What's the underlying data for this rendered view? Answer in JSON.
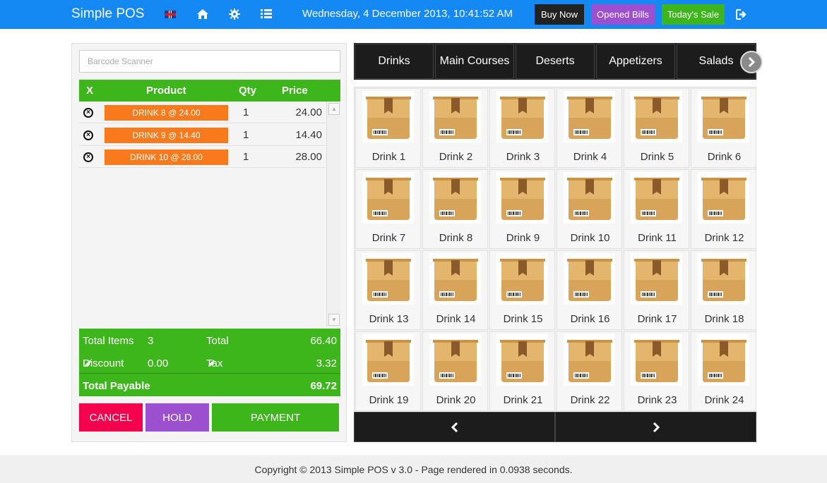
{
  "nav": {
    "brand": "Simple POS",
    "language_icon": "uk-flag-icon",
    "date": "Wednesday, 4 December 2013, 10:41:52 AM",
    "buy_now": "Buy Now",
    "opened_bills": "Opened Bills",
    "todays_sale": "Today's Sale",
    "icons": [
      "home-icon",
      "gear-icon",
      "list-icon",
      "logout-icon"
    ]
  },
  "colors": {
    "navbar": "#1489f4",
    "green": "#3db61c",
    "orange": "#f87a1c",
    "purple": "#9c4fce",
    "red": "#f5004c",
    "dark": "#1c1c1c"
  },
  "order": {
    "barcode_placeholder": "Barcode Scanner",
    "headers": {
      "x": "X",
      "product": "Product",
      "qty": "Qty",
      "price": "Price"
    },
    "items": [
      {
        "product": "DRINK 8 @ 24.00",
        "qty": "1",
        "price": "24.00"
      },
      {
        "product": "DRINK 9 @ 14.40",
        "qty": "1",
        "price": "14.40"
      },
      {
        "product": "DRINK 10 @ 28.00",
        "qty": "1",
        "price": "28.00"
      }
    ],
    "totals": {
      "items_label": "Total Items",
      "items_value": "3",
      "total_label": "Total",
      "total_value": "66.40",
      "discount_label": "Discount",
      "discount_value": "0.00",
      "tax_label": "Tax",
      "tax_value": "3.32",
      "payable_label": "Total Payable",
      "payable_value": "69.72"
    },
    "actions": {
      "cancel": "CANCEL",
      "hold": "HOLD",
      "payment": "PAYMENT"
    }
  },
  "categories": [
    "Drinks",
    "Main Courses",
    "Deserts",
    "Appetizers",
    "Salads"
  ],
  "products": [
    "Drink 1",
    "Drink 2",
    "Drink 3",
    "Drink 4",
    "Drink 5",
    "Drink 6",
    "Drink 7",
    "Drink 8",
    "Drink 9",
    "Drink 10",
    "Drink 11",
    "Drink 12",
    "Drink 13",
    "Drink 14",
    "Drink 15",
    "Drink 16",
    "Drink 17",
    "Drink 18",
    "Drink 19",
    "Drink 20",
    "Drink 21",
    "Drink 22",
    "Drink 23",
    "Drink 24"
  ],
  "footer": "Copyright © 2013 Simple POS v 3.0 - Page rendered in 0.0938 seconds."
}
